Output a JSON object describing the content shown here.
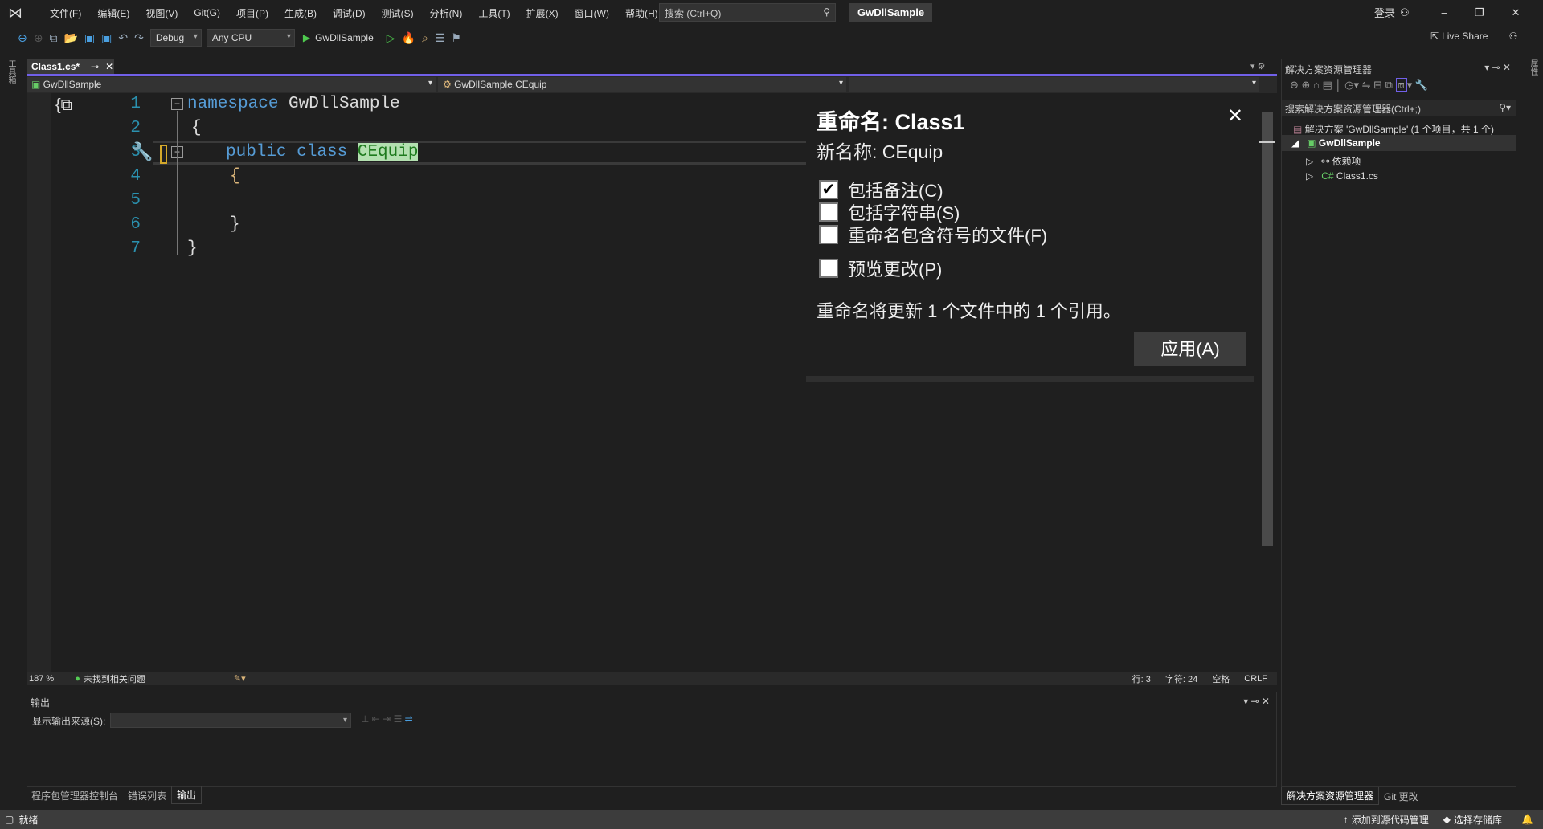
{
  "menu": [
    "文件(F)",
    "编辑(E)",
    "视图(V)",
    "Git(G)",
    "项目(P)",
    "生成(B)",
    "调试(D)",
    "测试(S)",
    "分析(N)",
    "工具(T)",
    "扩展(X)",
    "窗口(W)",
    "帮助(H)"
  ],
  "search_placeholder": "搜索 (Ctrl+Q)",
  "solution_name": "GwDllSample",
  "login": "登录",
  "toolbar": {
    "config": "Debug",
    "platform": "Any CPU",
    "run_target": "GwDllSample",
    "live_share": "Live Share"
  },
  "left_strip": "工具箱",
  "right_strip": "属性",
  "doc_tab": {
    "label": "Class1.cs*"
  },
  "navbar": {
    "project": "GwDllSample",
    "type": "GwDllSample.CEquip"
  },
  "code": {
    "lines": [
      "1",
      "2",
      "3",
      "4",
      "5",
      "6",
      "7"
    ],
    "l1_kw": "namespace",
    "l1_rest": " GwDllSample",
    "l2": "{",
    "l3_kw": "public class",
    "l3_name": "CEquip",
    "l4": "{",
    "l6": "}",
    "l7": "}"
  },
  "rename": {
    "title": "重命名: Class1",
    "new_name": "新名称: CEquip",
    "opt_comments": "包括备注(C)",
    "opt_strings": "包括字符串(S)",
    "opt_files": "重命名包含符号的文件(F)",
    "opt_preview": "预览更改(P)",
    "summary": "重命名将更新 1 个文件中的 1 个引用。",
    "apply": "应用(A)",
    "checked": [
      true,
      false,
      false,
      false
    ]
  },
  "editor_status": {
    "zoom": "187 %",
    "issues": "未找到相关问题",
    "line": "行: 3",
    "char": "字符: 24",
    "spaces": "空格",
    "eol": "CRLF"
  },
  "output": {
    "title": "输出",
    "source_label": "显示输出来源(S):"
  },
  "bottom_tabs": [
    "程序包管理器控制台",
    "错误列表",
    "输出"
  ],
  "solution_explorer": {
    "title": "解决方案资源管理器",
    "search": "搜索解决方案资源管理器(Ctrl+;)",
    "solution": "解决方案 'GwDllSample' (1 个项目，共 1 个)",
    "project": "GwDllSample",
    "deps": "依赖项",
    "file": "Class1.cs",
    "tabs": [
      "解决方案资源管理器",
      "Git 更改"
    ]
  },
  "statusbar": {
    "ready": "就绪",
    "add_source": "添加到源代码管理",
    "select_repo": "选择存储库"
  }
}
